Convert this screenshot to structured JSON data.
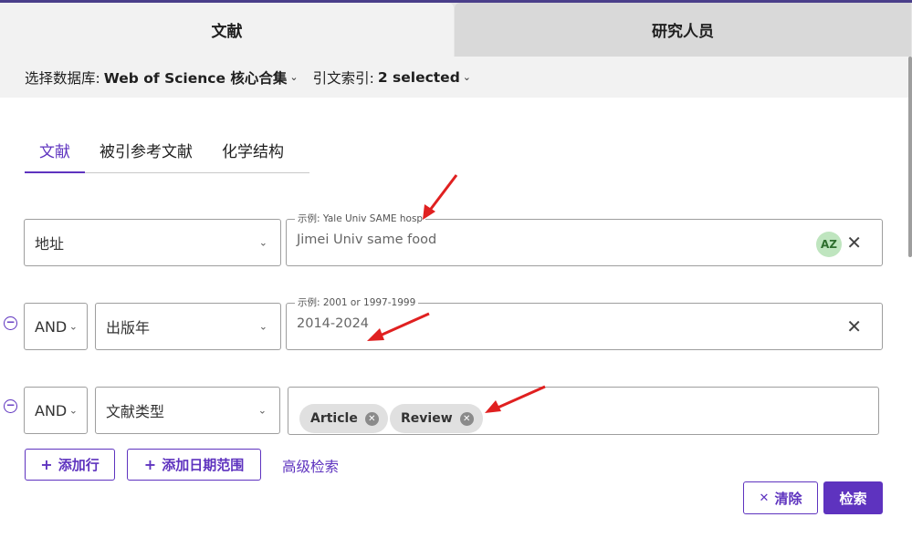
{
  "top_tabs": {
    "documents": "文献",
    "researchers": "研究人员"
  },
  "db_bar": {
    "select_db_label": "选择数据库:",
    "select_db_value": "Web of Science 核心合集",
    "citation_index_label": "引文索引:",
    "citation_index_value": "2 selected"
  },
  "sub_tabs": [
    "文献",
    "被引参考文献",
    "化学结构"
  ],
  "rows": [
    {
      "field": "地址",
      "example": "示例: Yale Univ SAME hosp",
      "value": "Jimei Univ same food"
    },
    {
      "operator": "AND",
      "field": "出版年",
      "example": "示例: 2001 or 1997-1999",
      "value": "2014-2024"
    },
    {
      "operator": "AND",
      "field": "文献类型",
      "chips": [
        "Article",
        "Review"
      ]
    }
  ],
  "icons": {
    "az": "AZ",
    "clear": "✕",
    "minus": "−",
    "chevron": "⌄",
    "plus": "+"
  },
  "actions": {
    "add_row": "添加行",
    "add_date_range": "添加日期范围",
    "advanced_search": "高级检索",
    "clear": "清除",
    "search": "检索"
  },
  "colors": {
    "accent": "#5e33bf",
    "annotation_arrow": "#e02020"
  }
}
